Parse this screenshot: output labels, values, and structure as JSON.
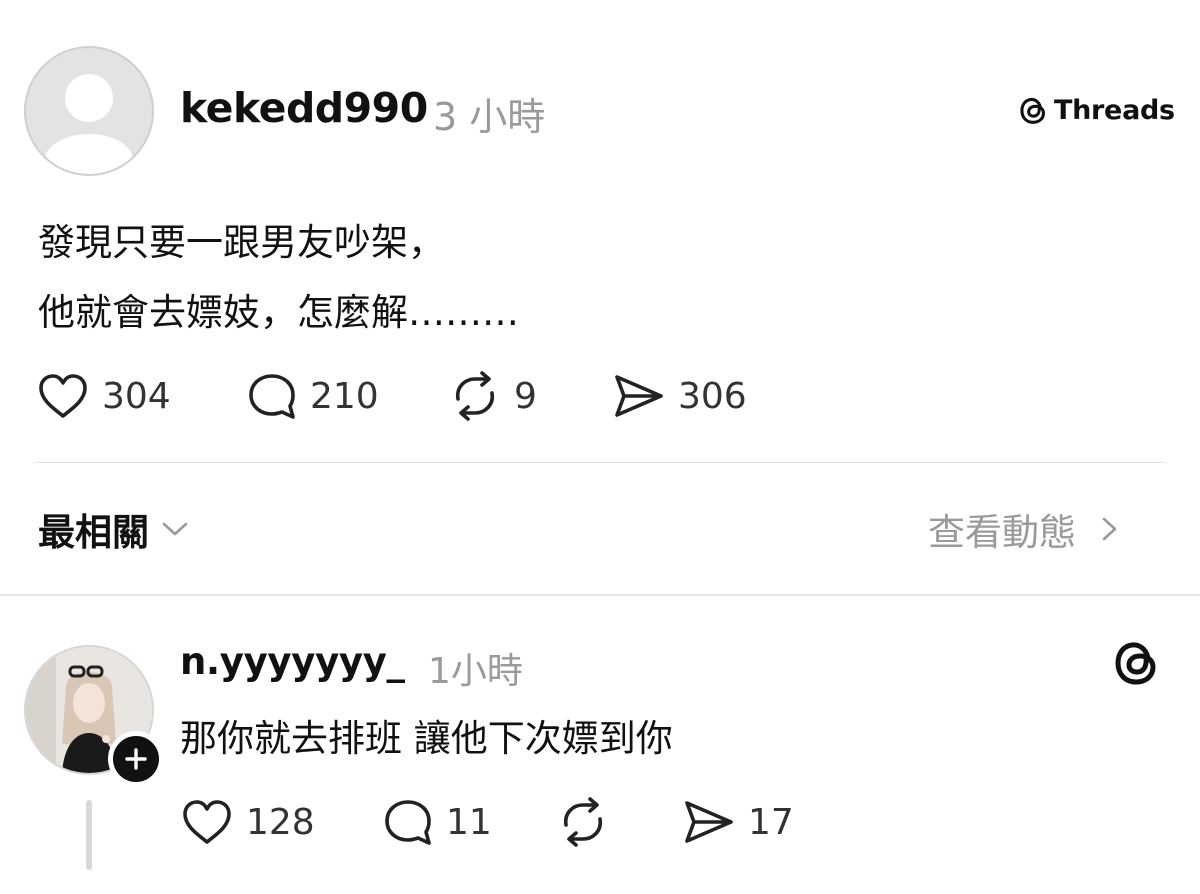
{
  "post": {
    "username": "kekedd990",
    "time": "3 小時",
    "platform_label": "Threads",
    "text_lines": [
      "發現只要一跟男友吵架，",
      "他就會去嫖妓，怎麼解………"
    ],
    "likes": "304",
    "replies": "210",
    "reposts": "9",
    "shares": "306"
  },
  "sort": {
    "label": "最相關",
    "activity_label": "查看動態"
  },
  "reply": {
    "username": "n.yyyyyyy_",
    "time": "1小時",
    "text": "那你就去排班 讓他下次嫖到你",
    "likes": "128",
    "replies": "11",
    "shares": "17"
  },
  "icons": {
    "like": "heart-icon",
    "reply": "comment-bubble-icon",
    "repost": "repost-icon",
    "share": "send-icon",
    "threads": "threads-logo-icon",
    "follow": "plus-icon",
    "sort": "chevron-down-icon",
    "activity": "chevron-right-icon"
  },
  "colors": {
    "text": "#111111",
    "muted": "#9a9a9a",
    "divider": "#e0e0e0"
  }
}
